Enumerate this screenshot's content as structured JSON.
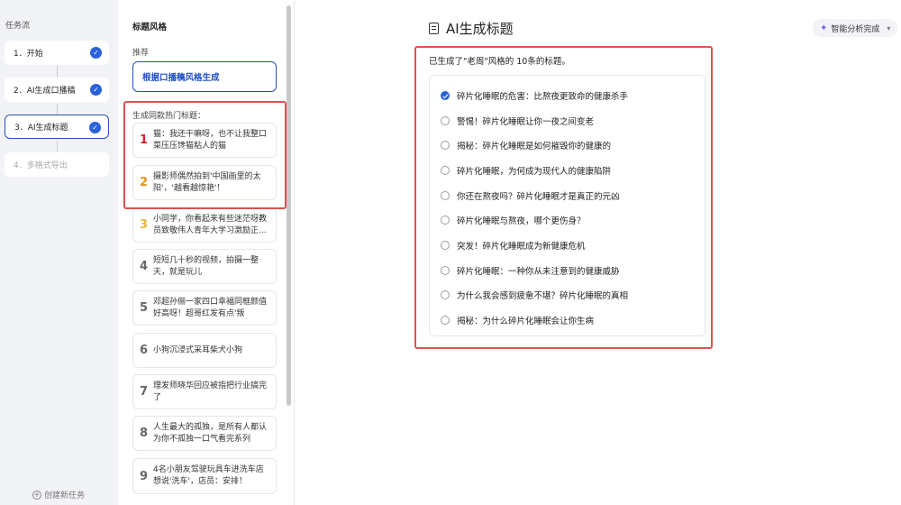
{
  "flow": {
    "title": "任务流",
    "steps": [
      {
        "label": "1．开始",
        "done": true
      },
      {
        "label": "2．AI生成口播稿",
        "done": true
      },
      {
        "label": "3．AI生成标题",
        "done": true,
        "active": true
      },
      {
        "label": "4．多格式导出",
        "done": false
      }
    ],
    "new_task": "创建新任务"
  },
  "style_panel": {
    "title": "标题风格",
    "recommend_label": "推荐",
    "recommend_button": "根据口播稿风格生成",
    "hot_label": "生成同款热门标题：",
    "hot_items": [
      {
        "num": "1",
        "text": "猫：我还干嘛呀，也不让我整口菜压压馋猫粘人的猫"
      },
      {
        "num": "2",
        "text": "摄影师偶然拍到'中国画里的太阳'，'越看越惊艳'！"
      },
      {
        "num": "3",
        "text": "小同学，你看起来有些迷茫呀教员致敬伟人青年大学习激励正..."
      },
      {
        "num": "4",
        "text": "短短几十秒的视频，拍摄一整天，就是玩儿"
      },
      {
        "num": "5",
        "text": "邓超孙俪一家四口幸福同框颜值好高呀！超哥红发有点'叛逆'电..."
      },
      {
        "num": "6",
        "text": "小狗沉浸式采耳柴犬小狗"
      },
      {
        "num": "7",
        "text": "理发师晓华回应被指把行业搞完了"
      },
      {
        "num": "8",
        "text": "人生最大的孤独，是所有人都认为你不孤独一口气看完系列"
      },
      {
        "num": "9",
        "text": "4名小朋友驾驶玩具车进洗车店想说'洗车'，店员：安排！"
      }
    ]
  },
  "main": {
    "title": "AI生成标题",
    "status_badge": "智能分析完成",
    "summary": "已生成了\"老周\"风格的 10条的标题。",
    "options": [
      {
        "text": "碎片化睡眠的危害：比熬夜更致命的健康杀手",
        "selected": true
      },
      {
        "text": "警惕！碎片化睡眠让你一夜之间变老",
        "selected": false
      },
      {
        "text": "揭秘：碎片化睡眠是如何摧毁你的健康的",
        "selected": false
      },
      {
        "text": "碎片化睡眠，为何成为现代人的健康陷阱",
        "selected": false
      },
      {
        "text": "你还在熬夜吗？碎片化睡眠才是真正的元凶",
        "selected": false
      },
      {
        "text": "碎片化睡眠与熬夜，哪个更伤身？",
        "selected": false
      },
      {
        "text": "突发！碎片化睡眠成为新健康危机",
        "selected": false
      },
      {
        "text": "碎片化睡眠：一种你从未注意到的健康威胁",
        "selected": false
      },
      {
        "text": "为什么我会感到疲惫不堪？碎片化睡眠的真相",
        "selected": false
      },
      {
        "text": "揭秘：为什么碎片化睡眠会让你生病",
        "selected": false
      }
    ]
  },
  "colors": {
    "accent": "#2a62d8",
    "highlight_box": "#d9534f"
  }
}
